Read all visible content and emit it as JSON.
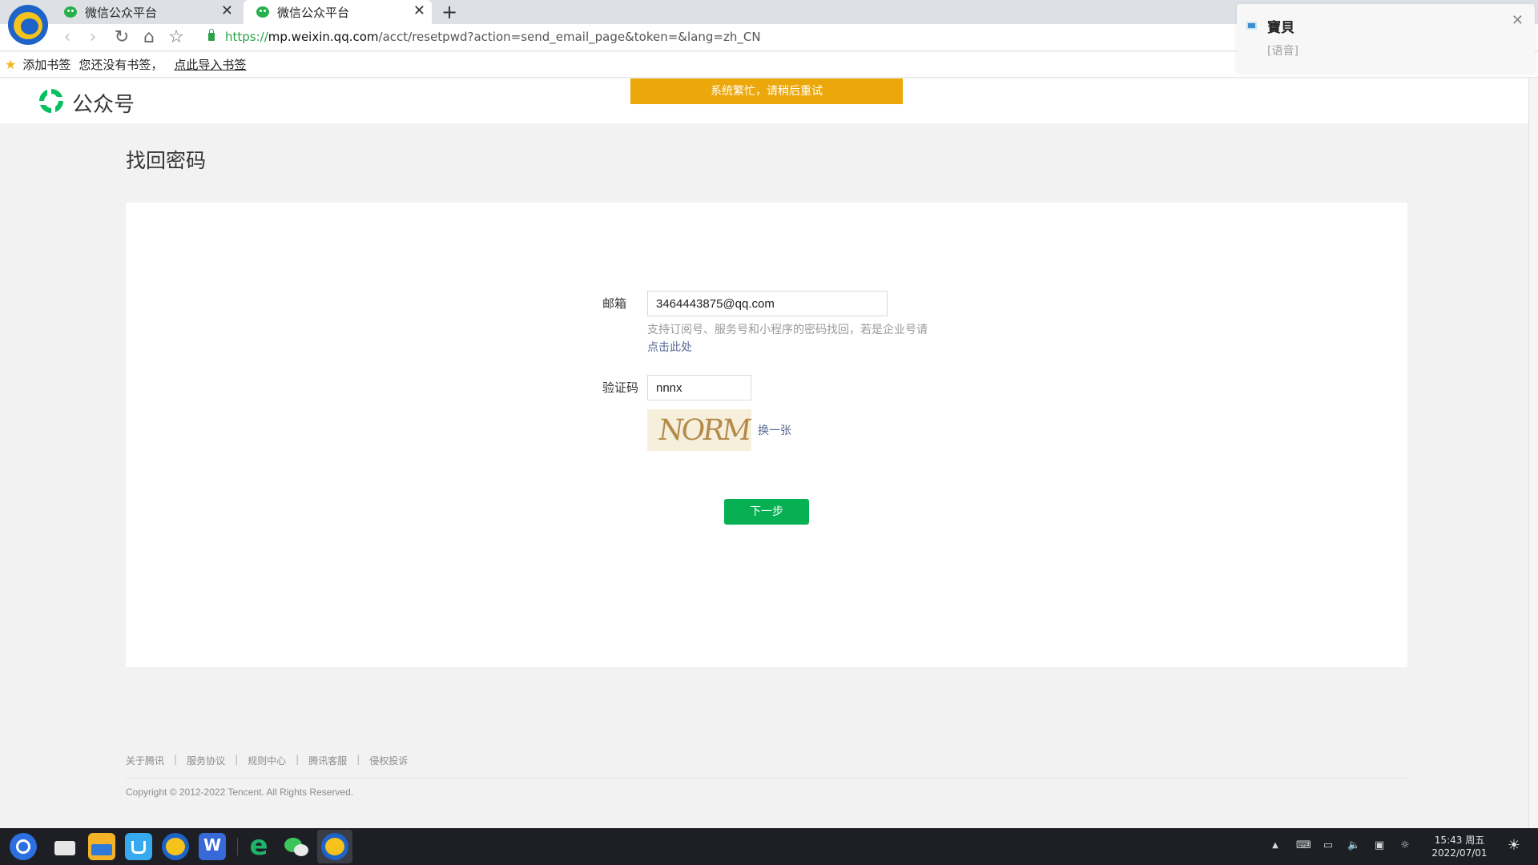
{
  "browser": {
    "tabs": [
      {
        "title": "微信公众平台"
      },
      {
        "title": "微信公众平台"
      }
    ],
    "url": {
      "scheme": "https://",
      "host": "mp.weixin.qq.com",
      "path": "/acct/resetpwd?action=send_email_page&token=&lang=zh_CN"
    },
    "bookmarks": {
      "add": "添加书签",
      "none": "您还没有书签，",
      "import": "点此导入书签"
    }
  },
  "page": {
    "logo_text": "公众号",
    "alert": "系统繁忙，请稍后重试",
    "title": "找回密码",
    "form": {
      "email_label": "邮箱",
      "email_value": "3464443875@qq.com",
      "email_tip": "支持订阅号、服务号和小程序的密码找回，若是企业号请",
      "email_tip_link": "点击此处",
      "captcha_label": "验证码",
      "captcha_value": "nnnx",
      "captcha_image_text": "NORM",
      "captcha_refresh": "换一张",
      "next_button": "下一步"
    },
    "footer": {
      "links": [
        "关于腾讯",
        "服务协议",
        "规则中心",
        "腾讯客服",
        "侵权投诉"
      ],
      "separator": "|",
      "copyright": "Copyright © 2012-2022 Tencent. All Rights Reserved."
    }
  },
  "notification": {
    "title": "寶貝",
    "body": "[语音]"
  },
  "taskbar": {
    "time": "15:43 周五",
    "date": "2022/07/01"
  },
  "colors": {
    "alert": "#eca70a",
    "primary_button": "#07b053",
    "link": "#576b95"
  }
}
